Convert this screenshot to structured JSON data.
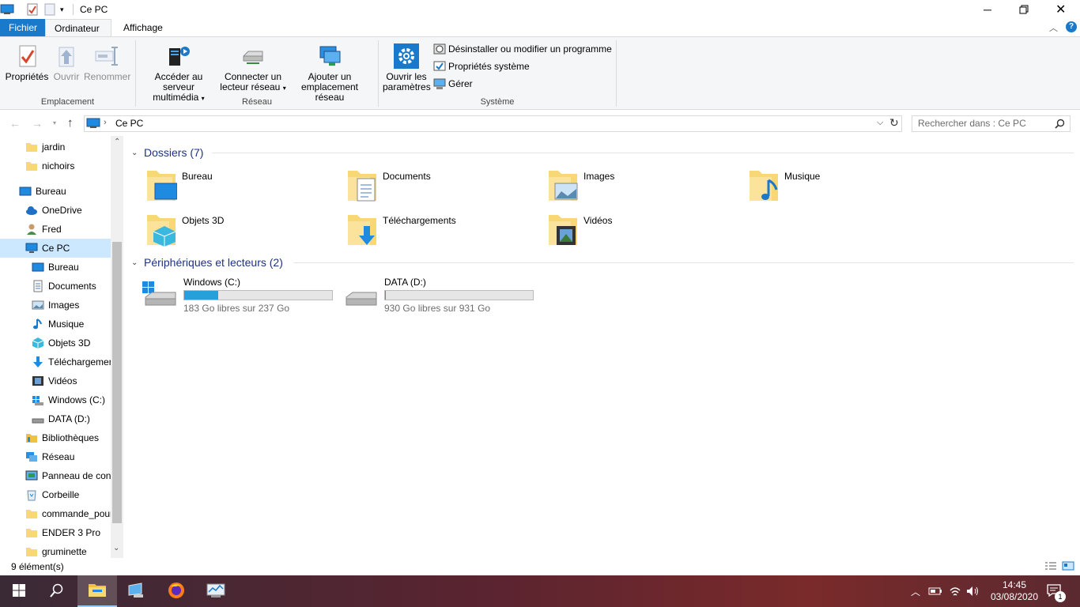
{
  "window": {
    "title": "Ce PC"
  },
  "ribbon": {
    "tabs": [
      {
        "label": "Fichier"
      },
      {
        "label": "Ordinateur"
      },
      {
        "label": "Affichage"
      }
    ],
    "emplacement": {
      "label": "Emplacement",
      "proprietes": "Propriétés",
      "ouvrir": "Ouvrir",
      "renommer": "Renommer"
    },
    "reseau": {
      "label": "Réseau",
      "media_line1": "Accéder au serveur",
      "media_line2": "multimédia",
      "connect_line1": "Connecter un",
      "connect_line2": "lecteur réseau",
      "add_line1": "Ajouter un",
      "add_line2": "emplacement réseau"
    },
    "systeme": {
      "label": "Système",
      "params_line1": "Ouvrir les",
      "params_line2": "paramètres",
      "uninstall": "Désinstaller ou modifier un programme",
      "sysprops": "Propriétés système",
      "gerer": "Gérer"
    }
  },
  "address": {
    "path": "Ce PC",
    "search_placeholder": "Rechercher dans : Ce PC"
  },
  "nav": {
    "items": [
      {
        "label": "jardin"
      },
      {
        "label": "nichoirs"
      },
      {
        "label": "Bureau"
      },
      {
        "label": "OneDrive"
      },
      {
        "label": "Fred"
      },
      {
        "label": "Ce PC"
      },
      {
        "label": "Bureau"
      },
      {
        "label": "Documents"
      },
      {
        "label": "Images"
      },
      {
        "label": "Musique"
      },
      {
        "label": "Objets 3D"
      },
      {
        "label": "Téléchargements"
      },
      {
        "label": "Vidéos"
      },
      {
        "label": "Windows (C:)"
      },
      {
        "label": "DATA (D:)"
      },
      {
        "label": "Bibliothèques"
      },
      {
        "label": "Réseau"
      },
      {
        "label": "Panneau de configuration"
      },
      {
        "label": "Corbeille"
      },
      {
        "label": "commande_pour"
      },
      {
        "label": "ENDER 3 Pro"
      },
      {
        "label": "gruminette"
      }
    ]
  },
  "main": {
    "folders_heading": "Dossiers (7)",
    "folders": [
      {
        "label": "Bureau"
      },
      {
        "label": "Documents"
      },
      {
        "label": "Images"
      },
      {
        "label": "Musique"
      },
      {
        "label": "Objets 3D"
      },
      {
        "label": "Téléchargements"
      },
      {
        "label": "Vidéos"
      }
    ],
    "drives_heading": "Périphériques et lecteurs (2)",
    "drives": [
      {
        "name": "Windows (C:)",
        "free": "183 Go libres sur 237 Go",
        "used_fraction": 0.23
      },
      {
        "name": "DATA (D:)",
        "free": "930 Go libres sur 931 Go",
        "used_fraction": 0.001
      }
    ]
  },
  "status": {
    "count": "9 élément(s)"
  },
  "taskbar": {
    "time": "14:45",
    "date": "03/08/2020",
    "notifications": "1"
  },
  "colors": {
    "accent": "#1979ca",
    "selection": "#cce8ff",
    "drive_bar": "#26a0da"
  }
}
